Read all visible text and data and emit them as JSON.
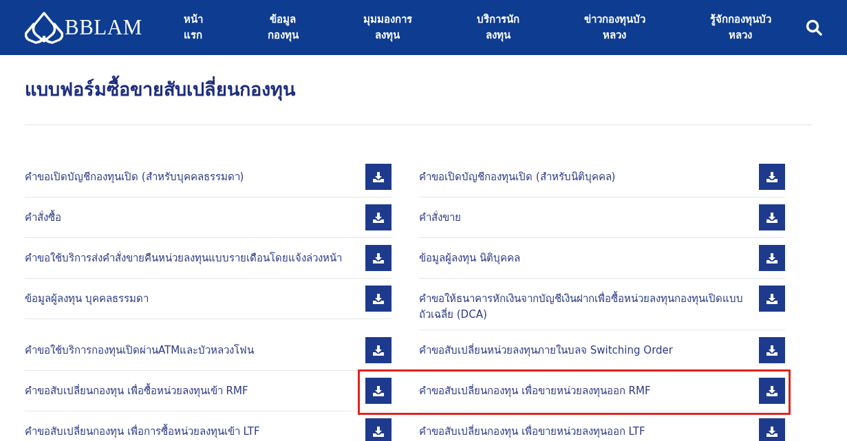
{
  "header": {
    "logo_text": "BBLAM",
    "nav": [
      {
        "lines": [
          "หน้า",
          "แรก"
        ]
      },
      {
        "lines": [
          "ข้อมูล",
          "กองทุน"
        ]
      },
      {
        "lines": [
          "มุมมองการ",
          "ลงทุน"
        ]
      },
      {
        "lines": [
          "บริการนัก",
          "ลงทุน"
        ]
      },
      {
        "lines": [
          "ข่าวกองทุนบัว",
          "หลวง"
        ]
      },
      {
        "lines": [
          "รู้จักกองทุนบัว",
          "หลวง"
        ]
      }
    ]
  },
  "page_title": "แบบฟอร์มซื้อขายสับเปลี่ยนกองทุน",
  "rows": [
    {
      "left": "คำขอเปิดบัญชีกองทุนเปิด (สำหรับบุคคลธรรมดา)",
      "right": "คำขอเปิดบัญชีกองทุนเปิด (สำหรับนิติบุคคล)",
      "highlighted": false
    },
    {
      "left": "คำสั่งซื้อ",
      "right": "คำสั่งขาย",
      "highlighted": false
    },
    {
      "left": "คำขอใช้บริการส่งคำสั่งขายคืนหน่วยลงทุนแบบรายเดือนโดยแจ้งล่วงหน้า",
      "right": "ข้อมูลผู้ลงทุน นิติบุคคล",
      "highlighted": false
    },
    {
      "left": "ข้อมูลผู้ลงทุน บุคคลธรรมดา",
      "right": "คำขอให้ธนาคารหักเงินจากบัญชีเงินฝากเพื่อซื้อหน่วยลงทุนกองทุนเปิดแบบถัวเฉลี่ย (DCA)",
      "highlighted": false
    },
    {
      "left": "คำขอใช้บริการกองทุนเปิดผ่านATMและบัวหลวงโฟน",
      "right": "คำขอสับเปลี่ยนหน่วยลงทุนภายในบลจ Switching Order",
      "highlighted": false
    },
    {
      "left": "คำขอสับเปลี่ยนกองทุน เพื่อซื้อหน่วยลงทุนเข้า RMF",
      "right": "คำขอสับเปลี่ยนกองทุน เพื่อขายหน่วยลงทุนออก RMF",
      "highlighted": true
    },
    {
      "left": "คำขอสับเปลี่ยนกองทุน เพื่อการซื้อหน่วยลงทุนเข้า LTF",
      "right": "คำขอสับเปลี่ยนกองทุน เพื่อขายหน่วยลงทุนออก LTF",
      "highlighted": false
    }
  ]
}
